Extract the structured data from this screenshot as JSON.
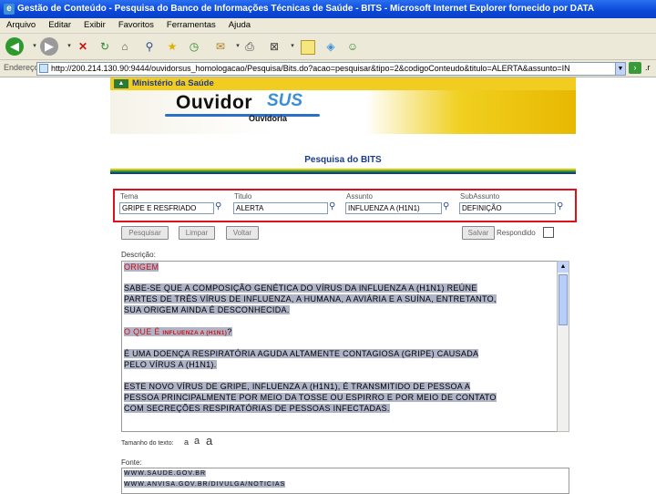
{
  "window": {
    "title": "Gestão de Conteúdo - Pesquisa do Banco de Informações Técnicas de Saúde - BITS - Microsoft Internet Explorer fornecido por DATA"
  },
  "menu": [
    "Arquivo",
    "Editar",
    "Exibir",
    "Favoritos",
    "Ferramentas",
    "Ajuda"
  ],
  "address": {
    "label": "Endereço",
    "url": "http://200.214.130.90:9444/ouvidorsus_homologacao/Pesquisa/Bits.do?acao=pesquisar&tipo=2&codigoConteudo&titulo=ALERTA&assunto=IN",
    "go_label": "›",
    "right_label": ".r"
  },
  "banner": {
    "ministry": "Ministério da Saúde",
    "brand_main": "Ouvidor",
    "brand_accent": "SUS",
    "brand_sub": "Ouvidoria"
  },
  "section_title": "Pesquisa do BITS",
  "search": {
    "fields": [
      {
        "label": "Tema",
        "value": "GRIPE E RESFRIADO"
      },
      {
        "label": "Titulo",
        "value": "ALERTA"
      },
      {
        "label": "Assunto",
        "value": "INFLUENZA A (H1N1)"
      },
      {
        "label": "SubAssunto",
        "value": "DEFINIÇÃO"
      }
    ]
  },
  "buttons": {
    "pesquisar": "Pesquisar",
    "limpar": "Limpar",
    "voltar": "Voltar",
    "salvar": "Salvar",
    "respondido": "Respondido"
  },
  "description": {
    "label": "Descrição:",
    "heading": "ORIGEM",
    "p1": [
      "SABE-SE QUE A COMPOSIÇÃO GENÉTICA DO VÍRUS DA INFLUENZA A (H1N1) REÚNE",
      "PARTES DE TRÊS VÍRUS DE INFLUENZA, A HUMANA, A AVIÁRIA E A SUÍNA, ENTRETANTO,",
      "SUA ORIGEM AINDA É DESCONHECIDA."
    ],
    "question_prefix": "O QUE É ",
    "question_term": "INFLUENZA A (H1N1)",
    "question_suffix": "?",
    "p2": [
      "É UMA DOENÇA RESPIRATÓRIA AGUDA ALTAMENTE CONTAGIOSA (GRIPE) CAUSADA",
      "PELO VÍRUS A (H1N1)."
    ],
    "p3": [
      "ESTE NOVO VÍRUS DE GRIPE, INFLUENZA A (H1N1), É TRANSMITIDO DE PESSOA A",
      "PESSOA PRINCIPALMENTE POR MEIO DA TOSSE OU ESPIRRO E POR MEIO DE CONTATO",
      "COM SECREÇÕES RESPIRATÓRIAS DE PESSOAS INFECTADAS."
    ]
  },
  "text_size": {
    "label": "Tamanho do texto:",
    "options": [
      "a",
      "a",
      "a"
    ]
  },
  "source": {
    "label": "Fonte:",
    "lines": [
      "WWW.SAUDE.GOV.BR",
      "WWW.ANVISA.GOV.BR/DIVULGA/NOTICIAS"
    ]
  },
  "colors": {
    "title_blue": "#0a48d8",
    "banner_yellow": "#e8c000",
    "highlight_red": "#e0101a",
    "stripe_green": "#1a9a3a",
    "stripe_blue": "#1c3a8a"
  }
}
